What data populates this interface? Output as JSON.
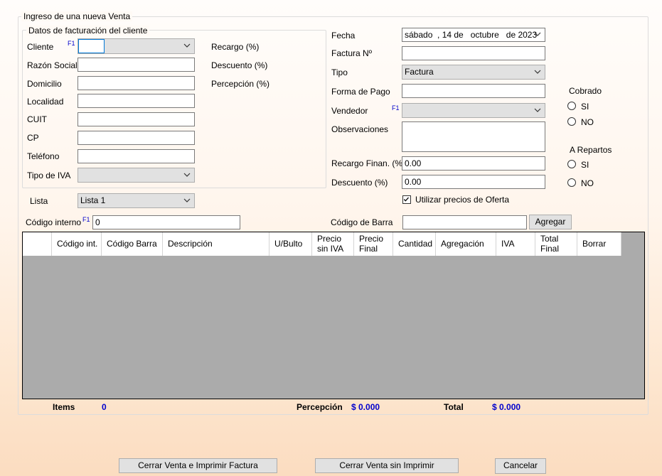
{
  "form": {
    "group_title": "Ingreso de una nueva Venta",
    "client_group_title": "Datos de facturación del cliente",
    "f1_hint": "F1",
    "labels": {
      "cliente": "Cliente",
      "razon_social": "Razón Social",
      "domicilio": "Domicilio",
      "localidad": "Localidad",
      "cuit": "CUIT",
      "cp": "CP",
      "telefono": "Teléfono",
      "tipo_iva": "Tipo de IVA",
      "recargo": "Recargo (%)",
      "descuento_pct": "Descuento (%)",
      "percepcion_pct": "Percepción (%)",
      "lista": "Lista",
      "codigo_interno": "Código interno",
      "fecha": "Fecha",
      "factura_no": "Factura Nº",
      "tipo": "Tipo",
      "forma_pago": "Forma de Pago",
      "vendedor": "Vendedor",
      "observaciones": "Observaciones",
      "recargo_finan": "Recargo Finan. (%)",
      "descuento": "Descuento (%)",
      "codigo_barra": "Código de Barra",
      "cobrado": "Cobrado",
      "a_repartos": "A Repartos",
      "si": "SI",
      "no": "NO",
      "utilizar_oferta": "Utilizar precios de Oferta"
    },
    "values": {
      "fecha": "sábado  , 14 de   octubre   de 2023",
      "tipo": "Factura",
      "lista": "Lista 1",
      "codigo_interno": "0",
      "recargo_finan": "0.00",
      "descuento": "0.00"
    },
    "agregar_button": "Agregar"
  },
  "grid": {
    "columns": [
      {
        "key": "codigo_int",
        "label": "Código int."
      },
      {
        "key": "codigo_barra",
        "label": "Código Barra"
      },
      {
        "key": "descripcion",
        "label": "Descripción"
      },
      {
        "key": "u_bulto",
        "label": "U/Bulto"
      },
      {
        "key": "precio_sin_iva",
        "label": "Precio sin IVA"
      },
      {
        "key": "precio_final",
        "label": "Precio Final"
      },
      {
        "key": "cantidad",
        "label": "Cantidad"
      },
      {
        "key": "agregacion",
        "label": "Agregación"
      },
      {
        "key": "iva",
        "label": "IVA"
      },
      {
        "key": "total_final",
        "label": "Total Final"
      },
      {
        "key": "borrar",
        "label": "Borrar"
      }
    ]
  },
  "summary": {
    "items_label": "Items",
    "items_value": "0",
    "percepcion_label": "Percepción",
    "percepcion_value": "$ 0.000",
    "total_label": "Total",
    "total_value": "$ 0.000"
  },
  "buttons": {
    "cerrar_imprimir": "Cerrar Venta e Imprimir Factura",
    "cerrar_sin_imprimir": "Cerrar Venta sin Imprimir",
    "cancelar": "Cancelar"
  }
}
